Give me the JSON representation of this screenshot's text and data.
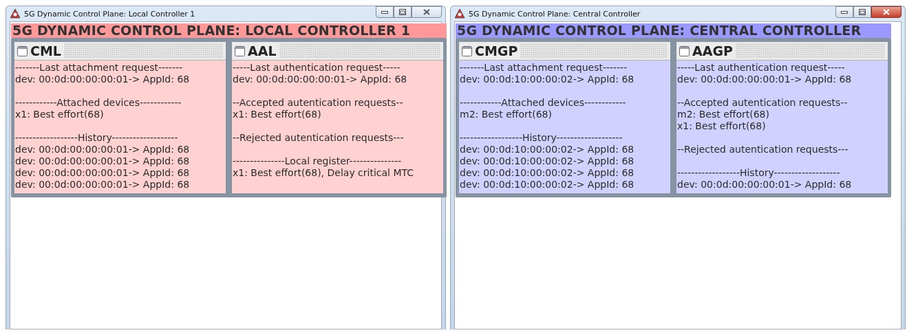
{
  "windows": [
    {
      "title": "5G Dynamic Control Plane: Local Controller 1",
      "active": false,
      "heading": "5G DYNAMIC CONTROL PLANE: LOCAL CONTROLLER 1",
      "color": "#ff9999",
      "panels": [
        {
          "title": "CML",
          "sections": [
            {
              "heading": "-------Last attachment request-------",
              "lines": [
                "dev: 00:0d:00:00:00:01-> AppId: 68"
              ]
            },
            {
              "heading": "------------Attached devices------------",
              "lines": [
                "x1: Best effort(68)"
              ]
            },
            {
              "heading": "------------------History-------------------",
              "lines": [
                "dev: 00:0d:00:00:00:01-> AppId: 68",
                "dev: 00:0d:00:00:00:01-> AppId: 68",
                "dev: 00:0d:00:00:00:01-> AppId: 68",
                "dev: 00:0d:00:00:00:01-> AppId: 68"
              ]
            }
          ]
        },
        {
          "title": "AAL",
          "sections": [
            {
              "heading": "-----Last authentication request-----",
              "lines": [
                "dev: 00:0d:00:00:00:01-> AppId: 68"
              ]
            },
            {
              "heading": "--Accepted autentication requests--",
              "lines": [
                "x1: Best effort(68)"
              ]
            },
            {
              "heading": "--Rejected autentication requests---"
            },
            {
              "heading": "---------------Local register---------------",
              "lines": [
                "x1: Best effort(68), Delay critical MTC"
              ]
            }
          ]
        }
      ]
    },
    {
      "title": "5G Dynamic Control Plane: Central Controller",
      "active": true,
      "heading": "5G DYNAMIC CONTROL PLANE: CENTRAL CONTROLLER",
      "color": "#9999ff",
      "panels": [
        {
          "title": "CMGP",
          "sections": [
            {
              "heading": "-------Last attachment request-------",
              "lines": [
                "dev: 00:0d:10:00:00:02-> AppId: 68"
              ]
            },
            {
              "heading": "------------Attached devices------------",
              "lines": [
                "m2: Best effort(68)"
              ]
            },
            {
              "heading": "------------------History-------------------",
              "lines": [
                "dev: 00:0d:10:00:00:02-> AppId: 68",
                "dev: 00:0d:10:00:00:02-> AppId: 68",
                "dev: 00:0d:10:00:00:02-> AppId: 68",
                "dev: 00:0d:10:00:00:02-> AppId: 68"
              ]
            }
          ]
        },
        {
          "title": "AAGP",
          "sections": [
            {
              "heading": "-----Last authentication request-----",
              "lines": [
                "dev: 00:0d:00:00:00:01-> AppId: 68"
              ]
            },
            {
              "heading": "--Accepted autentication requests--",
              "lines": [
                "m2: Best effort(68)",
                "x1: Best effort(68)"
              ]
            },
            {
              "heading": "--Rejected autentication requests---"
            },
            {
              "heading": "------------------History-------------------",
              "lines": [
                "dev: 00:0d:00:00:00:01-> AppId: 68"
              ]
            }
          ]
        }
      ]
    }
  ]
}
